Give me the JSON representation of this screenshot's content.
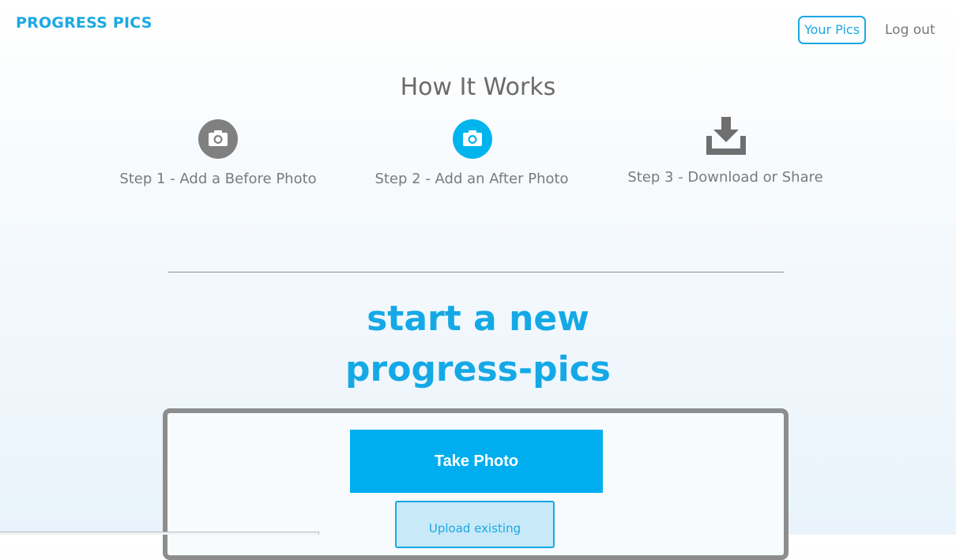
{
  "header": {
    "brand": "PROGRESS PICS",
    "nav": {
      "your_pics": "Your Pics",
      "log_out": "Log out"
    }
  },
  "how_it_works": {
    "title": "How It Works",
    "steps": [
      {
        "label": "Step 1 - Add a Before Photo",
        "icon": "camera-icon",
        "color": "#808080"
      },
      {
        "label": "Step 2 - Add an After Photo",
        "icon": "camera-icon",
        "color": "#00b5ee"
      },
      {
        "label": "Step 3 - Download or Share",
        "icon": "download-icon",
        "color": "#6f6f6f"
      }
    ]
  },
  "cta": {
    "line1": "start a new",
    "line2": "progress-pics",
    "take_photo": "Take Photo",
    "upload_existing": "Upload existing"
  },
  "colors": {
    "accent": "#1ba8e4",
    "button": "#00aeef",
    "muted_text": "#7a7a7a"
  }
}
